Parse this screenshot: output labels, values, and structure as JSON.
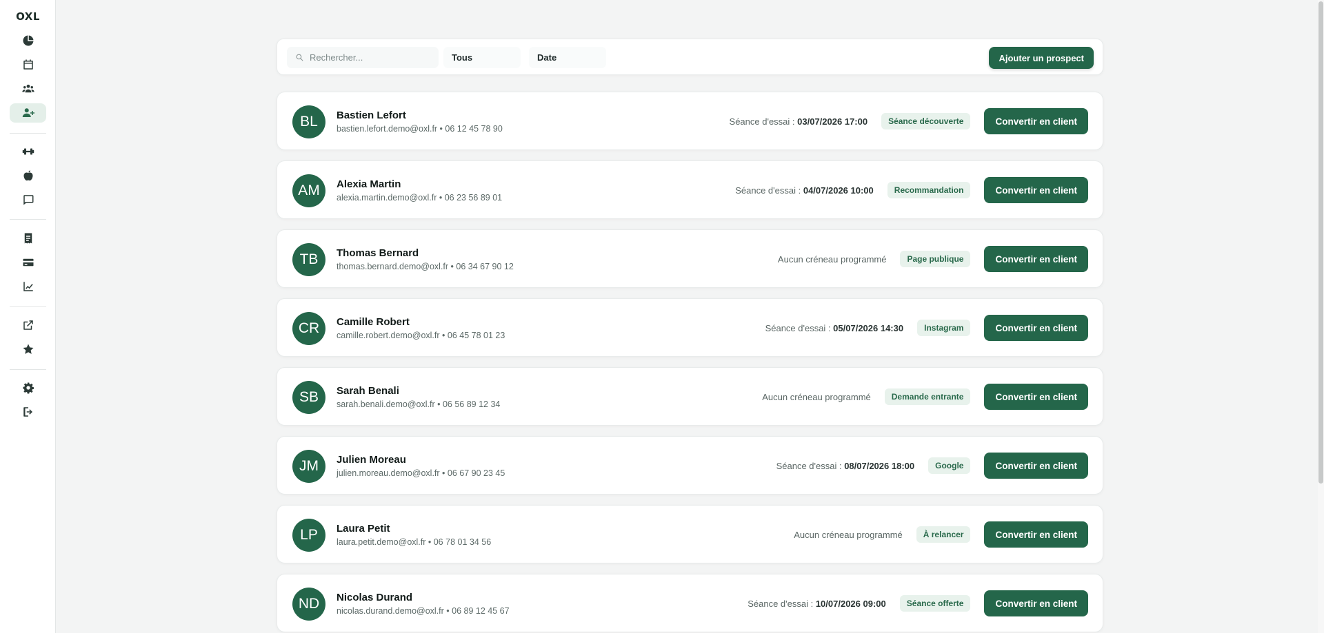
{
  "app": {
    "logo": "OXL"
  },
  "sidebar": {
    "items": [
      {
        "name": "dashboard",
        "icon": "pie-chart-icon",
        "active": false
      },
      {
        "name": "calendar",
        "icon": "calendar-icon",
        "active": false
      },
      {
        "name": "clients",
        "icon": "users-icon",
        "active": false
      },
      {
        "name": "prospects",
        "icon": "user-plus-icon",
        "active": true
      },
      {
        "name": "training",
        "icon": "dumbbell-icon",
        "active": false
      },
      {
        "name": "nutrition",
        "icon": "apple-icon",
        "active": false
      },
      {
        "name": "messages",
        "icon": "chat-icon",
        "active": false
      },
      {
        "name": "invoices",
        "icon": "receipt-icon",
        "active": false
      },
      {
        "name": "payments",
        "icon": "credit-card-icon",
        "active": false
      },
      {
        "name": "statistics",
        "icon": "chart-line-icon",
        "active": false
      },
      {
        "name": "public-page",
        "icon": "external-link-icon",
        "active": false
      },
      {
        "name": "reviews",
        "icon": "star-icon",
        "active": false
      },
      {
        "name": "settings",
        "icon": "gear-icon",
        "active": false
      },
      {
        "name": "logout",
        "icon": "logout-icon",
        "active": false
      }
    ]
  },
  "toolbar": {
    "search_placeholder": "Rechercher...",
    "filter_status": "Tous",
    "filter_date": "Date",
    "add_label": "Ajouter un prospect"
  },
  "prospects": [
    {
      "initials": "BL",
      "name": "Bastien Lefort",
      "contact": "bastien.lefort.demo@oxl.fr • 06 12 45 78 90",
      "session_label": "Séance d'essai : ",
      "session_date": "03/07/2026 17:00",
      "tag": "Séance découverte",
      "action": "Convertir en client"
    },
    {
      "initials": "AM",
      "name": "Alexia Martin",
      "contact": "alexia.martin.demo@oxl.fr • 06 23 56 89 01",
      "session_label": "Séance d'essai : ",
      "session_date": "04/07/2026 10:00",
      "tag": "Recommandation",
      "action": "Convertir en client"
    },
    {
      "initials": "TB",
      "name": "Thomas Bernard",
      "contact": "thomas.bernard.demo@oxl.fr • 06 34 67 90 12",
      "session_label": "Aucun créneau programmé",
      "session_date": "",
      "tag": "Page publique",
      "action": "Convertir en client"
    },
    {
      "initials": "CR",
      "name": "Camille Robert",
      "contact": "camille.robert.demo@oxl.fr • 06 45 78 01 23",
      "session_label": "Séance d'essai : ",
      "session_date": "05/07/2026 14:30",
      "tag": "Instagram",
      "action": "Convertir en client"
    },
    {
      "initials": "SB",
      "name": "Sarah Benali",
      "contact": "sarah.benali.demo@oxl.fr • 06 56 89 12 34",
      "session_label": "Aucun créneau programmé",
      "session_date": "",
      "tag": "Demande entrante",
      "action": "Convertir en client"
    },
    {
      "initials": "JM",
      "name": "Julien Moreau",
      "contact": "julien.moreau.demo@oxl.fr • 06 67 90 23 45",
      "session_label": "Séance d'essai : ",
      "session_date": "08/07/2026 18:00",
      "tag": "Google",
      "action": "Convertir en client"
    },
    {
      "initials": "LP",
      "name": "Laura Petit",
      "contact": "laura.petit.demo@oxl.fr • 06 78 01 34 56",
      "session_label": "Aucun créneau programmé",
      "session_date": "",
      "tag": "À relancer",
      "action": "Convertir en client"
    },
    {
      "initials": "ND",
      "name": "Nicolas Durand",
      "contact": "nicolas.durand.demo@oxl.fr • 06 89 12 45 67",
      "session_label": "Séance d'essai : ",
      "session_date": "10/07/2026 09:00",
      "tag": "Séance offerte",
      "action": "Convertir en client"
    }
  ]
}
